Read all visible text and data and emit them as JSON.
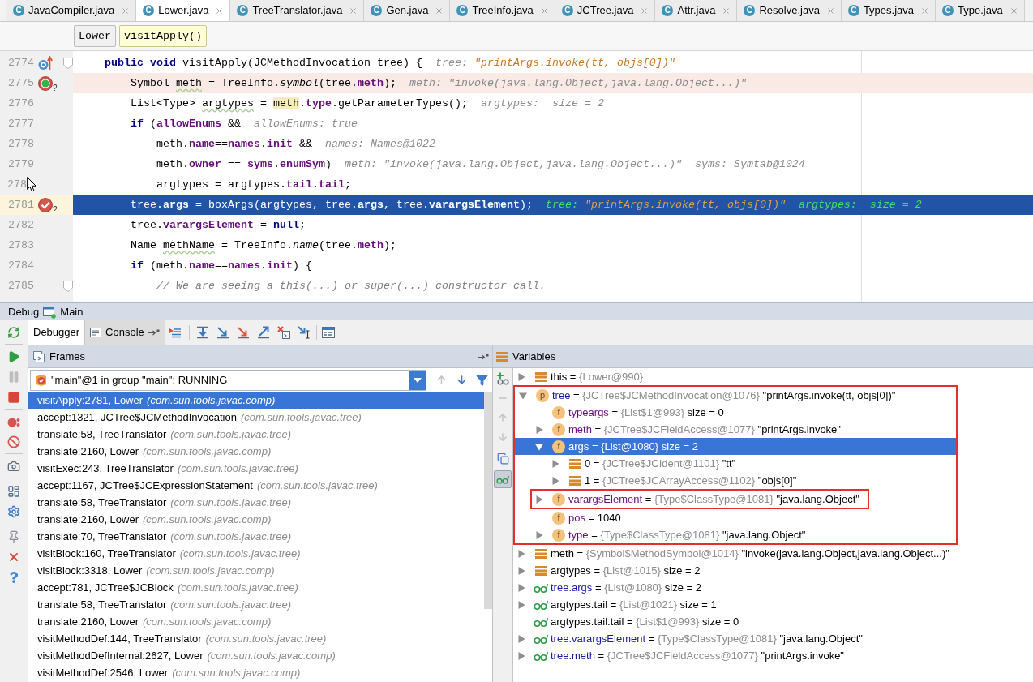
{
  "tabs": [
    {
      "label": "JavaCompiler.java",
      "badge": "C",
      "selected": false
    },
    {
      "label": "Lower.java",
      "badge": "C",
      "selected": true
    },
    {
      "label": "TreeTranslator.java",
      "badge": "C",
      "selected": false
    },
    {
      "label": "Gen.java",
      "badge": "C",
      "selected": false
    },
    {
      "label": "TreeInfo.java",
      "badge": "C",
      "selected": false
    },
    {
      "label": "JCTree.java",
      "badge": "C",
      "selected": false
    },
    {
      "label": "Attr.java",
      "badge": "C",
      "selected": false
    },
    {
      "label": "Resolve.java",
      "badge": "C",
      "selected": false
    },
    {
      "label": "Types.java",
      "badge": "C",
      "selected": false
    },
    {
      "label": "Type.java",
      "badge": "C",
      "selected": false
    }
  ],
  "breadcrumbs": [
    {
      "label": "Lower",
      "selected": false
    },
    {
      "label": "visitApply()",
      "selected": true
    }
  ],
  "editor": {
    "lines": [
      {
        "number": "2774",
        "overrides": true,
        "breakpoint": false,
        "current": false,
        "foldable": true,
        "pointer": false,
        "code": [
          {
            "text": "public void",
            "kind": "keyword"
          },
          {
            "text": " visitApply(JCMethodInvocation tree) {",
            "kind": "plain"
          }
        ],
        "hint": [
          {
            "text": "tree: ",
            "kind": "label"
          },
          {
            "text": "\"printArgs.invoke(tt, objs[0])\"",
            "kind": "changed"
          }
        ],
        "children": [
          {
            "number": "2775",
            "overrides": false,
            "breakpoint": true,
            "current": false,
            "marker_note": "?",
            "foldable": false,
            "pointer": false,
            "code": [
              {
                "text": "Symbol ",
                "kind": "plain"
              },
              {
                "text": "meth",
                "kind": "typo"
              },
              {
                "text": " = TreeInfo.",
                "kind": "plain"
              },
              {
                "text": "symbol",
                "kind": "static"
              },
              {
                "text": "(tree.",
                "kind": "plain"
              },
              {
                "text": "meth",
                "kind": "field"
              },
              {
                "text": ");",
                "kind": "plain"
              }
            ],
            "hint": [
              {
                "text": "meth: \"invoke(java.lang.Object,java.lang.Object...)\"",
                "kind": "label"
              }
            ]
          },
          {
            "number": "2776",
            "overrides": false,
            "breakpoint": false,
            "current": false,
            "foldable": false,
            "pointer": false,
            "code": [
              {
                "text": "List<Type> ",
                "kind": "plain"
              },
              {
                "text": "argtypes",
                "kind": "typo"
              },
              {
                "text": " = ",
                "kind": "plain"
              },
              {
                "text": "meth",
                "kind": "usage"
              },
              {
                "text": ".",
                "kind": "plain"
              },
              {
                "text": "type",
                "kind": "field"
              },
              {
                "text": ".getParameterTypes();",
                "kind": "plain"
              }
            ],
            "hint": [
              {
                "text": "argtypes:  size = 2",
                "kind": "label"
              }
            ]
          },
          {
            "number": "2777",
            "overrides": false,
            "breakpoint": false,
            "current": false,
            "foldable": false,
            "pointer": false,
            "code": [
              {
                "text": "if",
                "kind": "keyword"
              },
              {
                "text": " (",
                "kind": "plain"
              },
              {
                "text": "allowEnums",
                "kind": "field"
              },
              {
                "text": " &&",
                "kind": "plain"
              }
            ],
            "hint": [
              {
                "text": "allowEnums: true",
                "kind": "label"
              }
            ],
            "children": [
              {
                "number": "2778",
                "overrides": false,
                "breakpoint": false,
                "current": false,
                "foldable": false,
                "pointer": false,
                "code": [
                  {
                    "text": "meth.",
                    "kind": "plain"
                  },
                  {
                    "text": "name",
                    "kind": "field"
                  },
                  {
                    "text": "==",
                    "kind": "plain"
                  },
                  {
                    "text": "names",
                    "kind": "field"
                  },
                  {
                    "text": ".",
                    "kind": "plain"
                  },
                  {
                    "text": "init",
                    "kind": "field"
                  },
                  {
                    "text": " &&",
                    "kind": "plain"
                  }
                ],
                "hint": [
                  {
                    "text": "names: Names@1022",
                    "kind": "label"
                  }
                ]
              },
              {
                "number": "2779",
                "overrides": false,
                "breakpoint": false,
                "current": false,
                "foldable": false,
                "pointer": false,
                "code": [
                  {
                    "text": "meth.",
                    "kind": "plain"
                  },
                  {
                    "text": "owner",
                    "kind": "field"
                  },
                  {
                    "text": " == ",
                    "kind": "plain"
                  },
                  {
                    "text": "syms",
                    "kind": "field"
                  },
                  {
                    "text": ".",
                    "kind": "plain"
                  },
                  {
                    "text": "enumSym",
                    "kind": "field"
                  },
                  {
                    "text": ")",
                    "kind": "plain"
                  }
                ],
                "hint": [
                  {
                    "text": "meth: \"invoke(java.lang.Object,java.lang.Object...)\"  syms: Symtab@1024",
                    "kind": "label"
                  }
                ]
              },
              {
                "number": "278",
                "overrides": false,
                "breakpoint": false,
                "current": false,
                "foldable": false,
                "pointer": true,
                "code": [
                  {
                    "text": "argtypes = argtypes.",
                    "kind": "plain"
                  },
                  {
                    "text": "tail",
                    "kind": "field"
                  },
                  {
                    "text": ".",
                    "kind": "plain"
                  },
                  {
                    "text": "tail",
                    "kind": "field"
                  },
                  {
                    "text": ";",
                    "kind": "plain"
                  }
                ]
              }
            ]
          },
          {
            "number": "2781",
            "overrides": false,
            "breakpoint": true,
            "current": true,
            "marker_note": "?",
            "foldable": false,
            "pointer": false,
            "code": [
              {
                "text": "tree.",
                "kind": "plain"
              },
              {
                "text": "args",
                "kind": "field"
              },
              {
                "text": " = boxArgs(argtypes, tree.",
                "kind": "plain"
              },
              {
                "text": "args",
                "kind": "field"
              },
              {
                "text": ", tree.",
                "kind": "plain"
              },
              {
                "text": "varargsElement",
                "kind": "field"
              },
              {
                "text": ");",
                "kind": "plain"
              }
            ],
            "hint": [
              {
                "text": "tree: ",
                "kind": "label"
              },
              {
                "text": "\"printArgs.invoke(tt, objs[0])\"",
                "kind": "changed"
              },
              {
                "text": "  argtypes:  size = 2",
                "kind": "label"
              }
            ]
          },
          {
            "number": "2782",
            "overrides": false,
            "breakpoint": false,
            "current": false,
            "foldable": false,
            "pointer": false,
            "code": [
              {
                "text": "tree.",
                "kind": "plain"
              },
              {
                "text": "varargsElement",
                "kind": "field"
              },
              {
                "text": " = ",
                "kind": "plain"
              },
              {
                "text": "null",
                "kind": "keyword"
              },
              {
                "text": ";",
                "kind": "plain"
              }
            ]
          },
          {
            "number": "2783",
            "overrides": false,
            "breakpoint": false,
            "current": false,
            "foldable": false,
            "pointer": false,
            "code": [
              {
                "text": "Name ",
                "kind": "plain"
              },
              {
                "text": "methName",
                "kind": "typo"
              },
              {
                "text": " = TreeInfo.",
                "kind": "plain"
              },
              {
                "text": "name",
                "kind": "static"
              },
              {
                "text": "(tree.",
                "kind": "plain"
              },
              {
                "text": "meth",
                "kind": "field"
              },
              {
                "text": ");",
                "kind": "plain"
              }
            ]
          },
          {
            "number": "2784",
            "overrides": false,
            "breakpoint": false,
            "current": false,
            "foldable": false,
            "pointer": false,
            "code": [
              {
                "text": "if",
                "kind": "keyword"
              },
              {
                "text": " (meth.",
                "kind": "plain"
              },
              {
                "text": "name",
                "kind": "field"
              },
              {
                "text": "==",
                "kind": "plain"
              },
              {
                "text": "names",
                "kind": "field"
              },
              {
                "text": ".",
                "kind": "plain"
              },
              {
                "text": "init",
                "kind": "field"
              },
              {
                "text": ") {",
                "kind": "plain"
              }
            ],
            "children": [
              {
                "number": "2785",
                "overrides": false,
                "breakpoint": false,
                "current": false,
                "foldable": true,
                "pointer": false,
                "code": [
                  {
                    "text": "// We are seeing a this(...) or super(...) constructor call.",
                    "kind": "comment"
                  }
                ]
              }
            ]
          }
        ]
      }
    ]
  },
  "debug": {
    "title": "Debug",
    "configuration": "Main",
    "tabs": [
      {
        "label": "Debugger",
        "kind": "debugger",
        "selected": true
      },
      {
        "label": "Console",
        "kind": "console",
        "selected": false
      }
    ]
  },
  "frames": {
    "title": "Frames",
    "thread": "\"main\"@1 in group \"main\": RUNNING",
    "items": [
      {
        "method": "visitApply:2781, Lower",
        "package": "(com.sun.tools.javac.comp)",
        "selected": true
      },
      {
        "method": "accept:1321, JCTree$JCMethodInvocation",
        "package": "(com.sun.tools.javac.tree)",
        "selected": false
      },
      {
        "method": "translate:58, TreeTranslator",
        "package": "(com.sun.tools.javac.tree)",
        "selected": false
      },
      {
        "method": "translate:2160, Lower",
        "package": "(com.sun.tools.javac.comp)",
        "selected": false
      },
      {
        "method": "visitExec:243, TreeTranslator",
        "package": "(com.sun.tools.javac.tree)",
        "selected": false
      },
      {
        "method": "accept:1167, JCTree$JCExpressionStatement",
        "package": "(com.sun.tools.javac.tree)",
        "selected": false
      },
      {
        "method": "translate:58, TreeTranslator",
        "package": "(com.sun.tools.javac.tree)",
        "selected": false
      },
      {
        "method": "translate:2160, Lower",
        "package": "(com.sun.tools.javac.comp)",
        "selected": false
      },
      {
        "method": "translate:70, TreeTranslator",
        "package": "(com.sun.tools.javac.tree)",
        "selected": false
      },
      {
        "method": "visitBlock:160, TreeTranslator",
        "package": "(com.sun.tools.javac.tree)",
        "selected": false
      },
      {
        "method": "visitBlock:3318, Lower",
        "package": "(com.sun.tools.javac.comp)",
        "selected": false
      },
      {
        "method": "accept:781, JCTree$JCBlock",
        "package": "(com.sun.tools.javac.tree)",
        "selected": false
      },
      {
        "method": "translate:58, TreeTranslator",
        "package": "(com.sun.tools.javac.tree)",
        "selected": false
      },
      {
        "method": "translate:2160, Lower",
        "package": "(com.sun.tools.javac.comp)",
        "selected": false
      },
      {
        "method": "visitMethodDef:144, TreeTranslator",
        "package": "(com.sun.tools.javac.tree)",
        "selected": false
      },
      {
        "method": "visitMethodDefInternal:2627, Lower",
        "package": "(com.sun.tools.javac.comp)",
        "selected": false
      },
      {
        "method": "visitMethodDef:2546, Lower",
        "package": "(com.sun.tools.javac.comp)",
        "selected": false
      }
    ]
  },
  "variables": {
    "title": "Variables",
    "show_watches": true,
    "items": [
      {
        "name": "this",
        "eq": "=",
        "ref": "{Lower@990}",
        "kind": "local",
        "color": "#000000",
        "expanded": false,
        "selected": false,
        "highlighted": false
      },
      {
        "name": "tree",
        "eq": "=",
        "ref": "{JCTree$JCMethodInvocation@1076}",
        "value": "\"printArgs.invoke(tt, objs[0])\"",
        "kind": "parameter",
        "badge": "p",
        "color": "#1a1aa6",
        "expanded": true,
        "selected": false,
        "highlighted": true,
        "children": [
          {
            "name": "typeargs",
            "eq": "=",
            "ref": "{List$1@993}",
            "value": "size = 0",
            "kind": "field",
            "badge": "f",
            "color": "#660e7a",
            "selected": false,
            "highlighted": false
          },
          {
            "name": "meth",
            "eq": "=",
            "ref": "{JCTree$JCFieldAccess@1077}",
            "value": "\"printArgs.invoke\"",
            "kind": "field",
            "badge": "f",
            "color": "#660e7a",
            "expanded": false,
            "selected": false,
            "highlighted": false
          },
          {
            "name": "args",
            "eq": "=",
            "ref": "{List@1080}",
            "value": "size = 2",
            "kind": "field",
            "badge": "f",
            "expanded": true,
            "selected": true,
            "highlighted": false,
            "children": [
              {
                "name": "0",
                "eq": "=",
                "ref": "{JCTree$JCIdent@1101}",
                "value": "\"tt\"",
                "kind": "local",
                "expanded": false,
                "selected": false,
                "highlighted": false
              },
              {
                "name": "1",
                "eq": "=",
                "ref": "{JCTree$JCArrayAccess@1102}",
                "value": "\"objs[0]\"",
                "kind": "local",
                "expanded": false,
                "selected": false,
                "highlighted": false
              }
            ]
          },
          {
            "name": "varargsElement",
            "eq": "=",
            "ref": "{Type$ClassType@1081}",
            "value": "\"java.lang.Object\"",
            "kind": "field",
            "badge": "f",
            "color": "#660e7a",
            "expanded": false,
            "selected": false,
            "highlighted": true
          },
          {
            "name": "pos",
            "eq": "=",
            "value": "1040",
            "kind": "field",
            "badge": "f",
            "color": "#660e7a",
            "selected": false,
            "highlighted": false
          },
          {
            "name": "type",
            "eq": "=",
            "ref": "{Type$ClassType@1081}",
            "value": "\"java.lang.Object\"",
            "kind": "field",
            "badge": "f",
            "color": "#660e7a",
            "expanded": false,
            "selected": false,
            "highlighted": false
          }
        ]
      },
      {
        "name": "meth",
        "eq": "=",
        "ref": "{Symbol$MethodSymbol@1014}",
        "value": "\"invoke(java.lang.Object,java.lang.Object...)\"",
        "kind": "local",
        "color": "#000000",
        "expanded": false,
        "selected": false,
        "highlighted": false
      },
      {
        "name": "argtypes",
        "eq": "=",
        "ref": "{List@1015}",
        "value": "size = 2",
        "kind": "local",
        "color": "#000000",
        "expanded": false,
        "selected": false,
        "highlighted": false
      },
      {
        "name": "tree.args",
        "eq": "=",
        "ref": "{List@1080}",
        "value": "size = 2",
        "kind": "watch",
        "color": "#1a1aa6",
        "expanded": false,
        "selected": false,
        "highlighted": false
      },
      {
        "name": "argtypes.tail",
        "eq": "=",
        "ref": "{List@1021}",
        "value": "size = 1",
        "kind": "watch",
        "color": "#000000",
        "expanded": false,
        "selected": false,
        "highlighted": false
      },
      {
        "name": "argtypes.tail.tail",
        "eq": "=",
        "ref": "{List$1@993}",
        "value": "size = 0",
        "kind": "watch",
        "color": "#000000",
        "selected": false,
        "highlighted": false
      },
      {
        "name": "tree.varargsElement",
        "eq": "=",
        "ref": "{Type$ClassType@1081}",
        "value": "\"java.lang.Object\"",
        "kind": "watch",
        "color": "#1a1aa6",
        "expanded": false,
        "selected": false,
        "highlighted": false
      },
      {
        "name": "tree.meth",
        "eq": "=",
        "ref": "{JCTree$JCFieldAccess@1077}",
        "value": "\"printArgs.invoke\"",
        "kind": "watch",
        "color": "#1a1aa6",
        "expanded": false,
        "selected": false,
        "highlighted": false
      }
    ]
  }
}
